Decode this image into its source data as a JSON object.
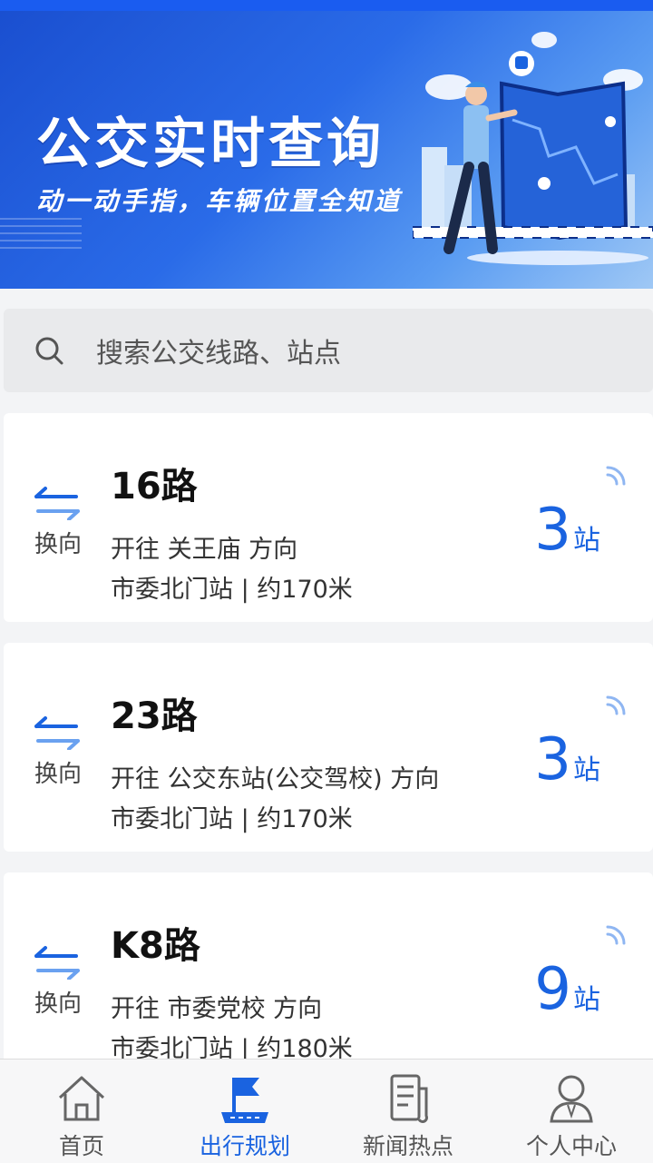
{
  "banner": {
    "title": "公交实时查询",
    "subtitle": "动一动手指，车辆位置全知道"
  },
  "search": {
    "placeholder": "搜索公交线路、站点"
  },
  "routes": [
    {
      "name": "16路",
      "swap_label": "换向",
      "direction": "开往 关王庙 方向",
      "stop_info": "市委北门站 | 约170米",
      "eta_count": "3",
      "eta_unit": "站"
    },
    {
      "name": "23路",
      "swap_label": "换向",
      "direction": "开往 公交东站(公交驾校) 方向",
      "stop_info": "市委北门站 | 约170米",
      "eta_count": "3",
      "eta_unit": "站"
    },
    {
      "name": "K8路",
      "swap_label": "换向",
      "direction": "开往 市委党校 方向",
      "stop_info": "市委北门站 | 约180米",
      "eta_count": "9",
      "eta_unit": "站"
    }
  ],
  "tabs": [
    {
      "label": "首页",
      "icon": "home-icon",
      "active": false
    },
    {
      "label": "出行规划",
      "icon": "flag-icon",
      "active": true
    },
    {
      "label": "新闻热点",
      "icon": "news-icon",
      "active": false
    },
    {
      "label": "个人中心",
      "icon": "person-icon",
      "active": false
    }
  ],
  "colors": {
    "accent": "#1a63e0",
    "banner": "#1a4fd0"
  }
}
